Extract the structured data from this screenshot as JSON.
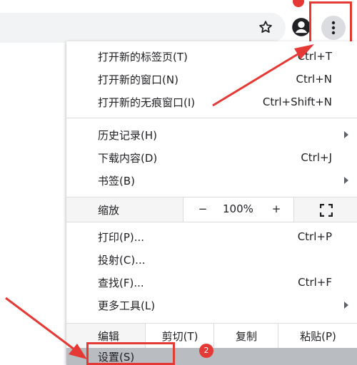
{
  "colors": {
    "accent_red": "#e53935",
    "menu_bg": "#ffffff",
    "row_bg": "#f5f5f5",
    "hover_bg": "#b9bcc0"
  },
  "toolbar": {
    "star_icon": "star-outline",
    "profile_icon": "account-circle",
    "menu_icon": "three-dots-vertical"
  },
  "menu": {
    "new_tab": {
      "label": "打开新的标签页(T)",
      "shortcut": "Ctrl+T"
    },
    "new_window": {
      "label": "打开新的窗口(N)",
      "shortcut": "Ctrl+N"
    },
    "new_incognito": {
      "label": "打开新的无痕窗口(I)",
      "shortcut": "Ctrl+Shift+N"
    },
    "history": {
      "label": "历史记录(H)"
    },
    "downloads": {
      "label": "下载内容(D)",
      "shortcut": "Ctrl+J"
    },
    "bookmarks": {
      "label": "书签(B)"
    },
    "zoom": {
      "label": "缩放",
      "minus": "−",
      "value": "100%",
      "plus": "+"
    },
    "print": {
      "label": "打印(P)...",
      "shortcut": "Ctrl+P"
    },
    "cast": {
      "label": "投射(C)..."
    },
    "find": {
      "label": "查找(F)...",
      "shortcut": "Ctrl+F"
    },
    "more_tools": {
      "label": "更多工具(L)"
    },
    "edit": {
      "label": "编辑",
      "cut": "剪切(T)",
      "copy": "复制",
      "paste": "粘贴(P)"
    },
    "settings": {
      "label": "设置(S)"
    }
  },
  "annotations": {
    "step2": "2"
  }
}
